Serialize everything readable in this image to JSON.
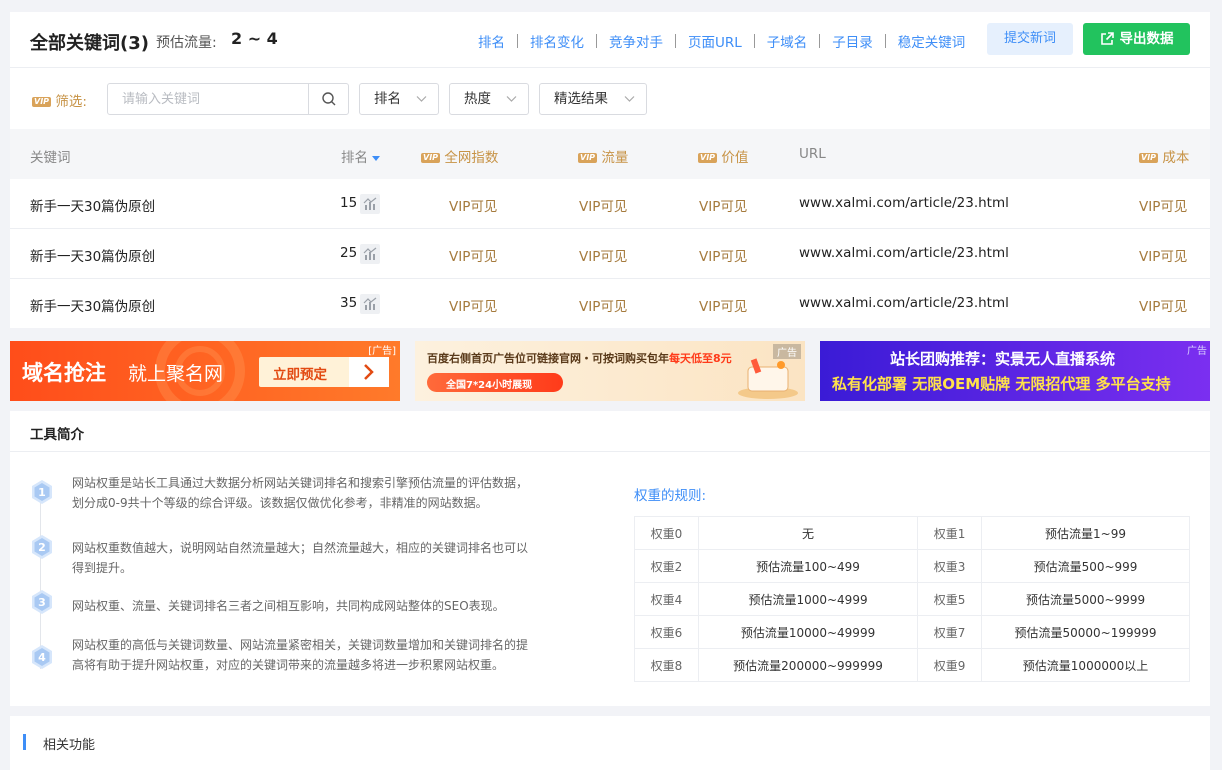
{
  "header": {
    "title": "全部关键词(3)",
    "flow_label": "预估流量:",
    "flow_value": "2 ~ 4",
    "tabs": [
      "排名",
      "排名变化",
      "竞争对手",
      "页面URL",
      "子域名",
      "子目录",
      "稳定关键词"
    ],
    "submit_button": "提交新词",
    "export_button": "导出数据"
  },
  "filter": {
    "vip_badge": "VIP",
    "label": "筛选:",
    "search_placeholder": "请输入关键词",
    "dropdowns": [
      "排名",
      "热度",
      "精选结果"
    ]
  },
  "table": {
    "vip_badge": "VIP",
    "headers": {
      "keyword": "关键词",
      "rank": "排名",
      "index": "全网指数",
      "traffic": "流量",
      "value": "价值",
      "url": "URL",
      "cost": "成本"
    },
    "rows": [
      {
        "keyword": "新手一天30篇伪原创",
        "rank": "15",
        "index": "VIP可见",
        "traffic": "VIP可见",
        "value": "VIP可见",
        "url": "www.xalmi.com/article/23.html",
        "cost": "VIP可见"
      },
      {
        "keyword": "新手一天30篇伪原创",
        "rank": "25",
        "index": "VIP可见",
        "traffic": "VIP可见",
        "value": "VIP可见",
        "url": "www.xalmi.com/article/23.html",
        "cost": "VIP可见"
      },
      {
        "keyword": "新手一天30篇伪原创",
        "rank": "35",
        "index": "VIP可见",
        "traffic": "VIP可见",
        "value": "VIP可见",
        "url": "www.xalmi.com/article/23.html",
        "cost": "VIP可见"
      }
    ]
  },
  "ads": {
    "ad1": {
      "text_a": "域名抢注",
      "text_b": "就上聚名网",
      "cta": "立即预定",
      "tag": "[广告]"
    },
    "ad2": {
      "line1": "百度右侧首页广告位可链接官网・可按词购买包年",
      "line1_hl": "每天低至8元",
      "line2": "全国7*24小时展现",
      "tag": "广告"
    },
    "ad3": {
      "line1": "站长团购推荐：实景无人直播系统",
      "line2": "私有化部署 无限OEM贴牌 无限招代理 多平台支持",
      "tag": "广告"
    }
  },
  "intro": {
    "title": "工具简介",
    "steps": [
      {
        "num": "1",
        "text": "网站权重是站长工具通过大数据分析网站关键词排名和搜索引擎预估流量的评估数据，划分成0-9共十个等级的综合评级。该数据仅做优化参考，非精准的网站数据。"
      },
      {
        "num": "2",
        "text": "网站权重数值越大，说明网站自然流量越大；自然流量越大，相应的关键词排名也可以得到提升。"
      },
      {
        "num": "3",
        "text": "网站权重、流量、关键词排名三者之间相互影响，共同构成网站整体的SEO表现。"
      },
      {
        "num": "4",
        "text": "网站权重的高低与关键词数量、网站流量紧密相关，关键词数量增加和关键词排名的提高将有助于提升网站权重，对应的关键词带来的流量越多将进一步积累网站权重。"
      }
    ],
    "rules_title": "权重的规则:",
    "rules": [
      [
        "权重0",
        "无",
        "权重1",
        "预估流量1~99"
      ],
      [
        "权重2",
        "预估流量100~499",
        "权重3",
        "预估流量500~999"
      ],
      [
        "权重4",
        "预估流量1000~4999",
        "权重5",
        "预估流量5000~9999"
      ],
      [
        "权重6",
        "预估流量10000~49999",
        "权重7",
        "预估流量50000~199999"
      ],
      [
        "权重8",
        "预估流量200000~999999",
        "权重9",
        "预估流量1000000以上"
      ]
    ]
  },
  "related": {
    "title": "相关功能"
  },
  "colors": {
    "accent": "#3e8ef7",
    "export_green": "#22c35e",
    "vip_gold": "#c79346",
    "ad_orange": "#ff5a1f",
    "ad_purple": "#5b2ee0"
  }
}
